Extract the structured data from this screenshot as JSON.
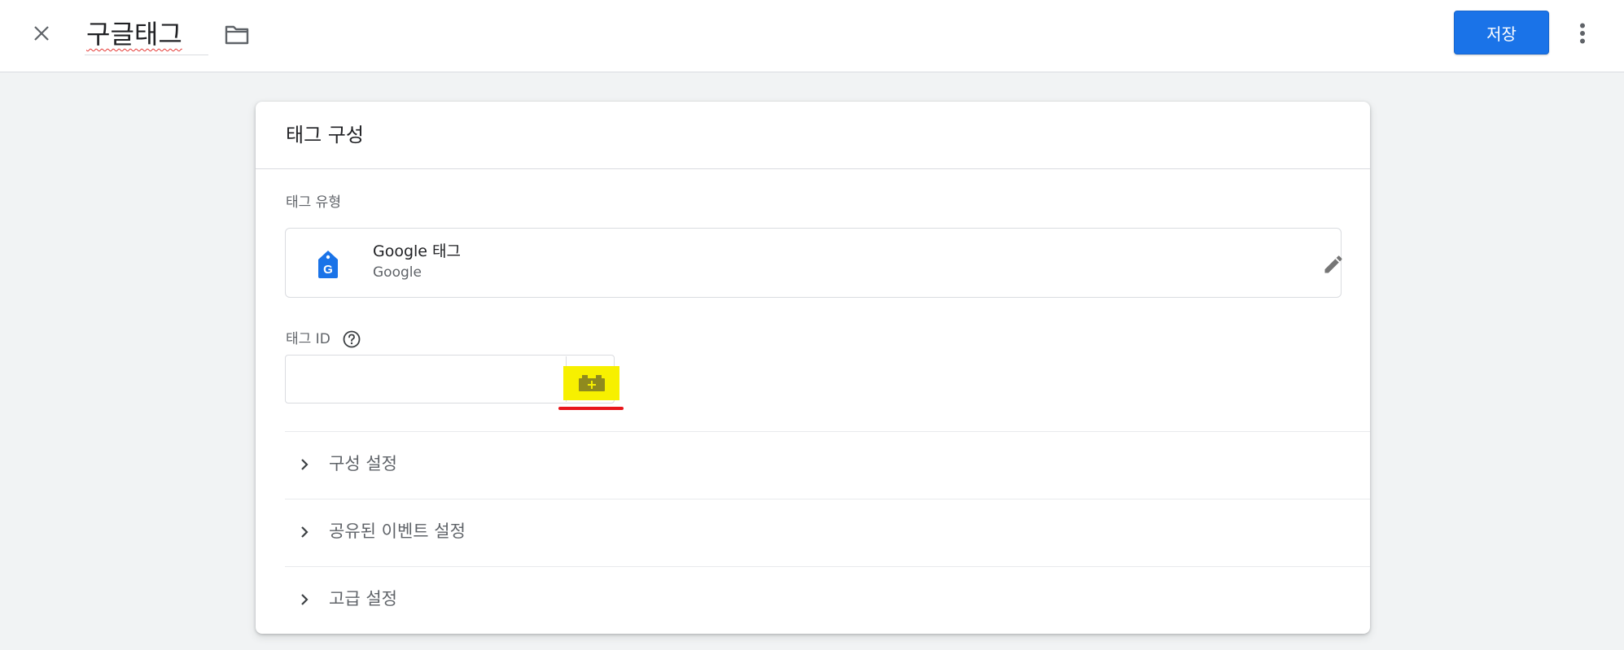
{
  "header": {
    "close_icon": "close-icon",
    "tag_name": "구글태그",
    "folder_icon": "folder-icon",
    "save_label": "저장",
    "more_icon": "more-vert-icon",
    "accent_color": "#1a73e8"
  },
  "card": {
    "title": "태그 구성",
    "tag_type_label": "태그 유형",
    "tag_type": {
      "name": "Google 태그",
      "vendor": "Google",
      "icon": "google-tag-icon",
      "edit_icon": "pencil-icon"
    },
    "tag_id": {
      "label": "태그 ID",
      "help_icon": "help-circle-icon",
      "value": "",
      "variable_icon": "variable-picker-icon",
      "highlight_color": "#f7f000",
      "underline_color": "#e8161b"
    },
    "sections": [
      {
        "label": "구성 설정",
        "icon": "chevron-right-icon"
      },
      {
        "label": "공유된 이벤트 설정",
        "icon": "chevron-right-icon"
      },
      {
        "label": "고급 설정",
        "icon": "chevron-right-icon"
      }
    ]
  }
}
